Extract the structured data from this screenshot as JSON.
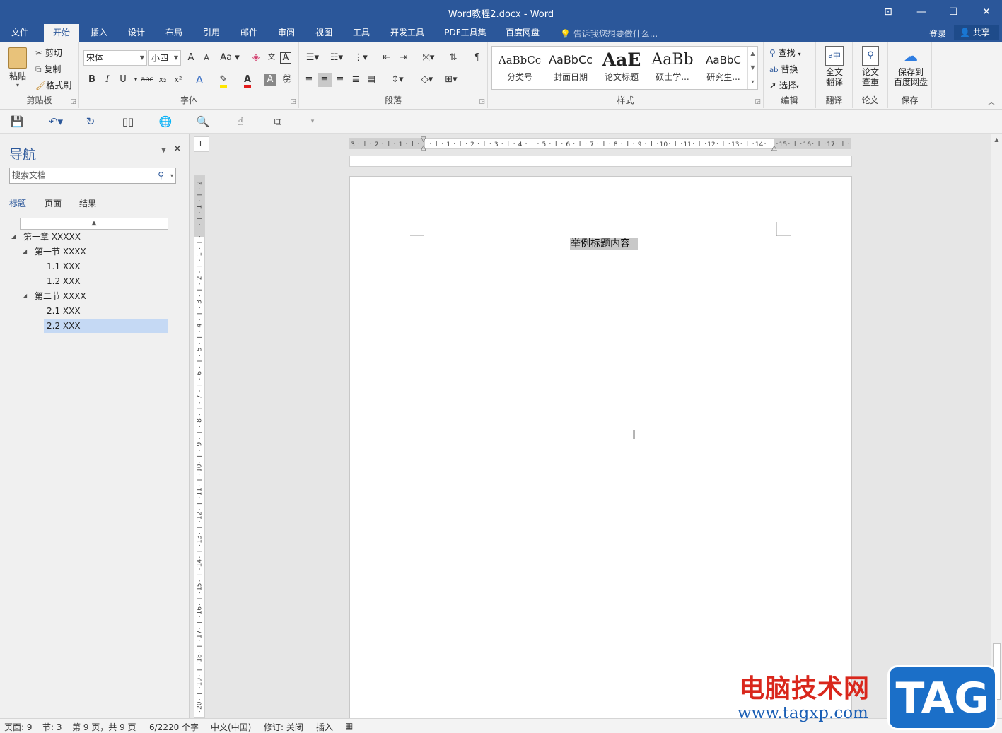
{
  "window": {
    "title": "Word教程2.docx - Word",
    "controls": {
      "ribbon_options": "⊡",
      "minimize": "—",
      "maximize": "☐",
      "close": "✕"
    }
  },
  "tabs": [
    "文件",
    "开始",
    "插入",
    "设计",
    "布局",
    "引用",
    "邮件",
    "审阅",
    "视图",
    "工具",
    "开发工具",
    "PDF工具集",
    "百度网盘"
  ],
  "active_tab": "开始",
  "tell_me": "告诉我您想要做什么...",
  "login": "登录",
  "share": "共享",
  "ribbon": {
    "clipboard": {
      "paste": "粘贴",
      "cut": "剪切",
      "copy": "复制",
      "format_painter": "格式刷",
      "label": "剪贴板"
    },
    "font": {
      "font_name": "宋体",
      "font_size": "小四",
      "grow": "A",
      "shrink": "A",
      "case": "Aa",
      "bold": "B",
      "italic": "I",
      "underline": "U",
      "strike": "abc",
      "sub": "x₂",
      "sup": "x²",
      "label": "字体"
    },
    "paragraph": {
      "label": "段落"
    },
    "styles": {
      "items": [
        {
          "sample": "AaBbCc",
          "name": "分类号"
        },
        {
          "sample": "AaBbCc",
          "name": "封面日期"
        },
        {
          "sample": "AaE",
          "name": "论文标题"
        },
        {
          "sample": "AaBb",
          "name": "硕士学..."
        },
        {
          "sample": "AaBbC",
          "name": "研究生..."
        }
      ],
      "label": "样式"
    },
    "editing": {
      "find": "查找",
      "replace": "替换",
      "select": "选择",
      "label": "编辑"
    },
    "translate": {
      "button": "全文\n翻译",
      "label": "翻译"
    },
    "thesis": {
      "button": "论文\n查重",
      "label": "论文"
    },
    "save": {
      "button": "保存到\n百度网盘",
      "label": "保存"
    }
  },
  "nav": {
    "title": "导航",
    "search_placeholder": "搜索文档",
    "tabs": [
      "标题",
      "页面",
      "结果"
    ],
    "active_tab": "标题",
    "tree": [
      {
        "label": "第一章 XXXXX",
        "level": 0,
        "expanded": true,
        "selected": false
      },
      {
        "label": "第一节 XXXX",
        "level": 1,
        "expanded": true,
        "selected": false
      },
      {
        "label": "1.1 XXX",
        "level": 2,
        "expanded": false,
        "selected": false
      },
      {
        "label": "1.2 XXX",
        "level": 2,
        "expanded": false,
        "selected": false
      },
      {
        "label": "第二节 XXXX",
        "level": 1,
        "expanded": true,
        "selected": false
      },
      {
        "label": "2.1 XXX",
        "level": 2,
        "expanded": false,
        "selected": false
      },
      {
        "label": "2.2 XXX",
        "level": 2,
        "expanded": false,
        "selected": true
      }
    ]
  },
  "ruler": {
    "corner": "L",
    "h_numbers": [
      "3",
      "2",
      "1",
      "",
      "1",
      "2",
      "3",
      "4",
      "5",
      "6",
      "7",
      "8",
      "9",
      "10",
      "11",
      "12",
      "13",
      "14",
      "15",
      "16",
      "17"
    ],
    "v_numbers": [
      "2",
      "1",
      "",
      "1",
      "2",
      "3",
      "4",
      "5",
      "6",
      "7",
      "8",
      "9",
      "10",
      "11",
      "12",
      "13",
      "14",
      "15",
      "16",
      "17",
      "18",
      "19",
      "20"
    ]
  },
  "document": {
    "heading": "举例标题内容"
  },
  "status": {
    "page": "页面: 9",
    "section": "节: 3",
    "page_of": "第 9 页，共 9 页",
    "words": "6/2220 个字",
    "language": "中文(中国)",
    "track_changes": "修订: 关闭",
    "insert_mode": "插入"
  },
  "watermark": {
    "text": "电脑技术网",
    "url": "www.tagxp.com",
    "badge": "TAG"
  }
}
